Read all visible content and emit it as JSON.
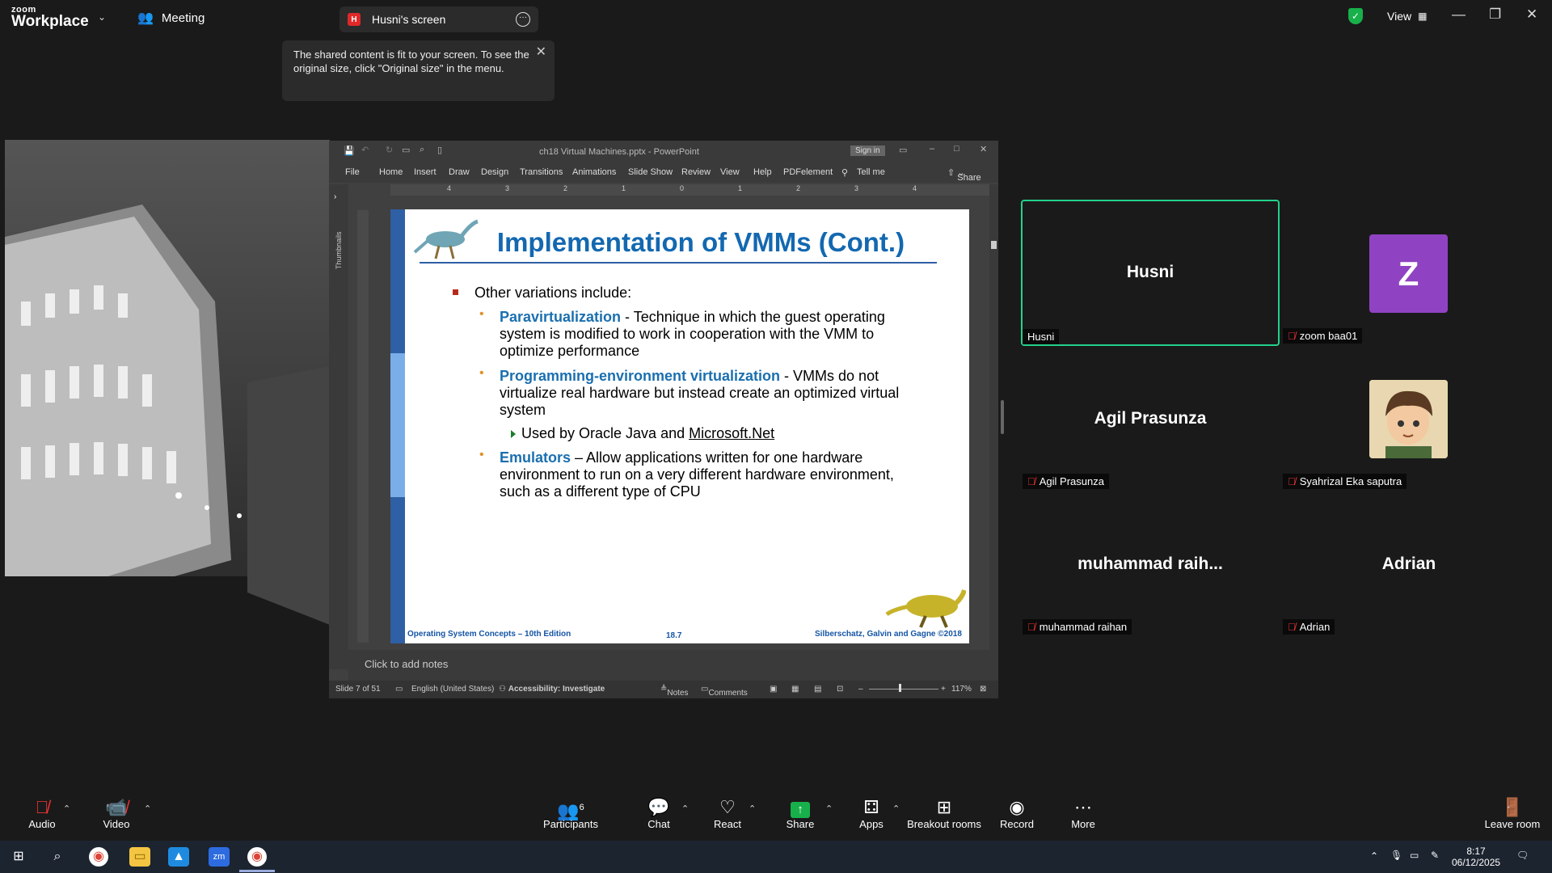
{
  "app": {
    "logo_top": "zoom",
    "logo_bottom": "Workplace"
  },
  "topbar": {
    "meeting_label": "Meeting",
    "share_tab_badge": "H",
    "share_tab_label": "Husni's screen",
    "view_label": "View"
  },
  "toast": {
    "text": "The shared content is fit to your screen. To see the original size, click \"Original size\" in the menu."
  },
  "ppt": {
    "window_title": "ch18 Virtual Machines.pptx  -  PowerPoint",
    "sign_in": "Sign in",
    "menu": [
      "File",
      "Home",
      "Insert",
      "Draw",
      "Design",
      "Transitions",
      "Animations",
      "Slide Show",
      "Review",
      "View",
      "Help",
      "PDFelement",
      "Tell me"
    ],
    "share_label": "Share",
    "thumbnails_label": "Thumbnails",
    "ruler_numbers": [
      "4",
      "3",
      "2",
      "1",
      "0",
      "1",
      "2",
      "3",
      "4"
    ],
    "notes_placeholder": "Click to add notes",
    "status": {
      "slide": "Slide 7 of 51",
      "language": "English (United States)",
      "accessibility": "Accessibility: Investigate",
      "notes": "Notes",
      "comments": "Comments",
      "zoom": "117%"
    },
    "slide": {
      "title": "Implementation of VMMs (Cont.)",
      "intro": "Other variations include:",
      "items": [
        {
          "keyword": "Paravirtualization",
          "text": " - Technique in which the guest operating system is modified to work in cooperation with the VMM to optimize performance"
        },
        {
          "keyword": "Programming-environment virtualization",
          "text": " - VMMs do not virtualize real hardware but instead create an optimized virtual system"
        },
        {
          "keyword": "Emulators",
          "text": " – Allow applications written for one hardware environment to run on a very different hardware environment, such as a different type of CPU"
        }
      ],
      "sub_item_prefix": "Used by Oracle Java and ",
      "sub_item_link": "Microsoft.Net",
      "footer_left": "Operating System Concepts – 10th Edition",
      "footer_mid": "18.7",
      "footer_right": "Silberschatz, Galvin and Gagne ©2018"
    }
  },
  "gallery": [
    {
      "display": "Husni",
      "label": "Husni",
      "muted": false
    },
    {
      "display": "Z",
      "label": "zoom baa01",
      "muted": true
    },
    {
      "display": "Agil Prasunza",
      "label": "Agil Prasunza",
      "muted": true
    },
    {
      "display": "",
      "label": "Syahrizal Eka saputra",
      "muted": true
    },
    {
      "display": "muhammad  raih...",
      "label": "muhammad raihan",
      "muted": true
    },
    {
      "display": "Adrian",
      "label": "Adrian",
      "muted": true
    }
  ],
  "toolbar": {
    "audio": "Audio",
    "video": "Video",
    "participants": "Participants",
    "participants_count": "6",
    "chat": "Chat",
    "react": "React",
    "share": "Share",
    "apps": "Apps",
    "breakout": "Breakout rooms",
    "record": "Record",
    "more": "More",
    "leave": "Leave room"
  },
  "taskbar": {
    "time": "8:17",
    "date": "06/12/2025"
  },
  "colors": {
    "accent_green": "#23d18b",
    "share_green": "#18b04a",
    "mute_red": "#e33333",
    "avatar_purple": "#8f43c2"
  }
}
